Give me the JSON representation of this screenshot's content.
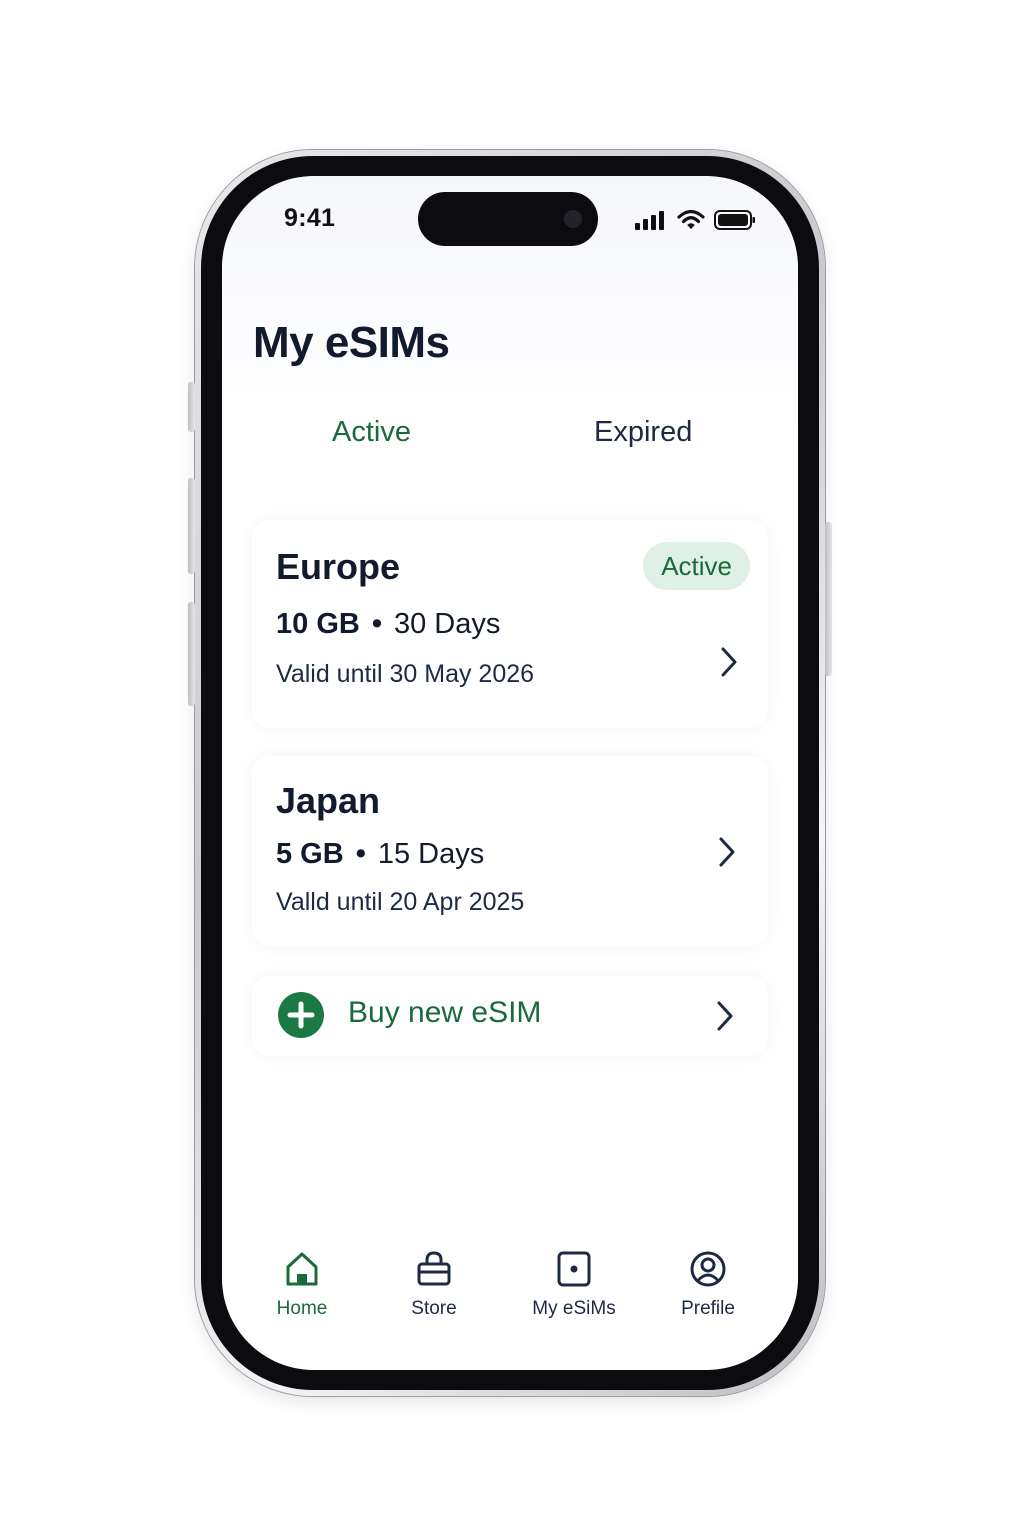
{
  "status_bar": {
    "time": "9:41",
    "icons": [
      "cellular-signal-icon",
      "wifi-icon",
      "battery-icon"
    ]
  },
  "page": {
    "title": "My eSIMs"
  },
  "tabs": [
    {
      "label": "Active",
      "selected": true
    },
    {
      "label": "Expired",
      "selected": false
    }
  ],
  "esims": [
    {
      "region": "Europe",
      "data": "10 GB",
      "separator": "•",
      "duration": "30 Days",
      "validity": "Valid until 30 May 2026",
      "status": "Active"
    },
    {
      "region": "Japan",
      "data": "5 GB",
      "separator": "•",
      "duration": "15 Days",
      "validity": "Valld until 20 Apr 2025"
    }
  ],
  "buy": {
    "label": "Buy new eSIM",
    "icon": "plus-circle-icon"
  },
  "bottom_nav": [
    {
      "label": "Home",
      "icon": "home-icon",
      "active": true
    },
    {
      "label": "Store",
      "icon": "shopping-bag-icon",
      "active": false
    },
    {
      "label": "My eSiMs",
      "icon": "sim-card-icon",
      "active": false
    },
    {
      "label": "Prefile",
      "icon": "profile-icon",
      "active": false
    }
  ],
  "colors": {
    "accent_green": "#1b6a3a",
    "badge_background": "#dff1e7",
    "text_dark": "#121a2e",
    "text_navy": "#1e2a44"
  }
}
